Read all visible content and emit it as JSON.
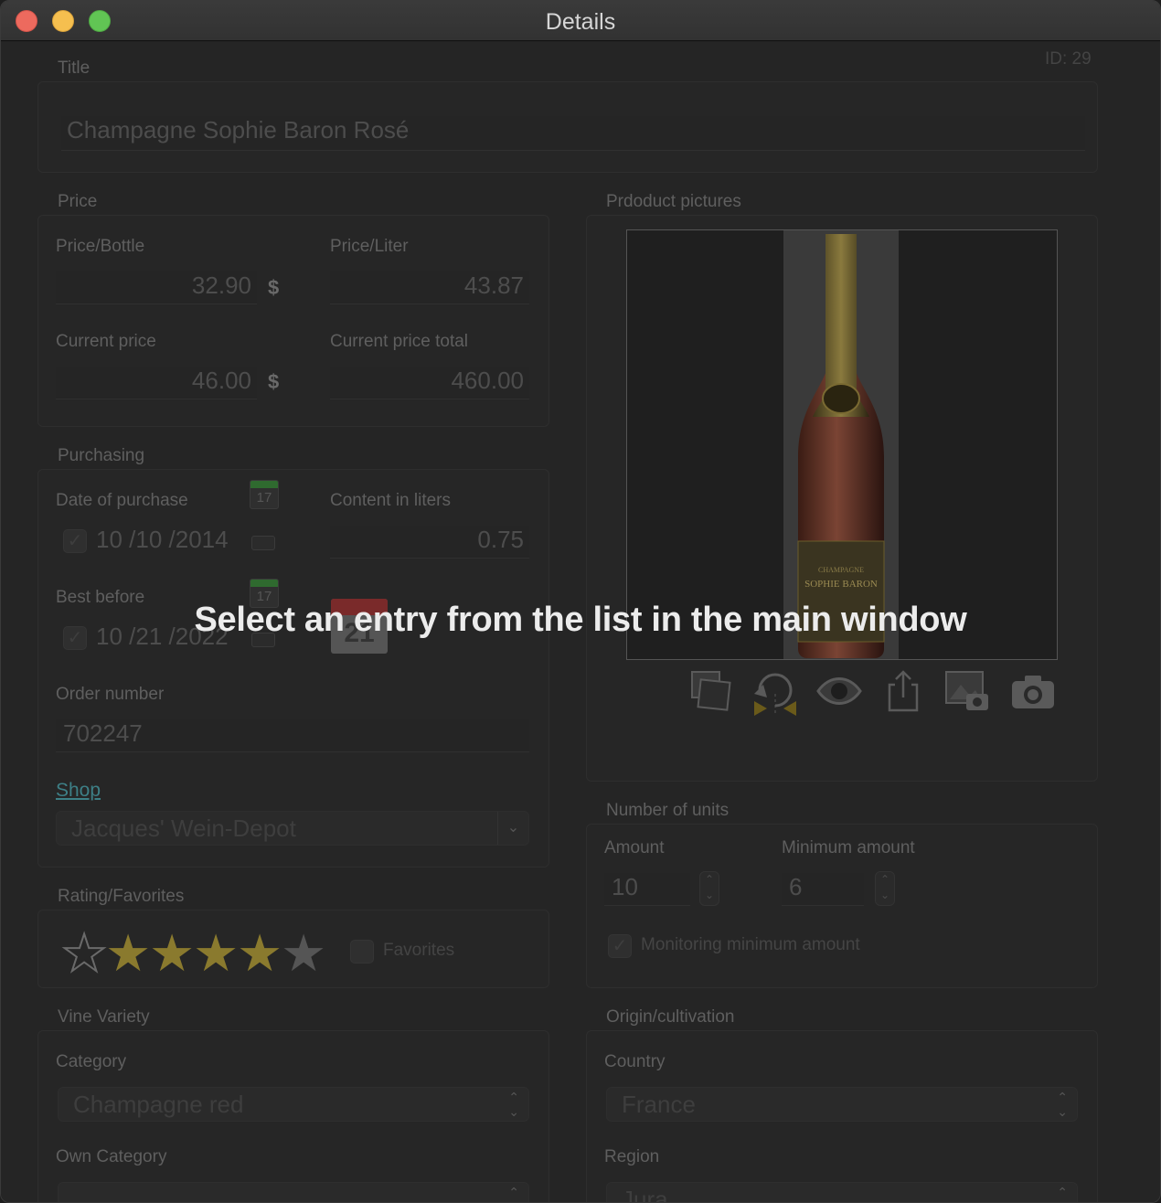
{
  "window": {
    "title": "Details"
  },
  "id_label": "ID: 29",
  "overlay_message": "Select an entry from the list in the main window",
  "title_section": {
    "label": "Title",
    "value": "Champagne Sophie Baron Rosé"
  },
  "price": {
    "label": "Price",
    "price_bottle_label": "Price/Bottle",
    "price_bottle_value": "32.90",
    "price_bottle_currency": "$",
    "price_liter_label": "Price/Liter",
    "price_liter_value": "43.87",
    "current_price_label": "Current price",
    "current_price_value": "46.00",
    "current_price_currency": "$",
    "current_total_label": "Current price total",
    "current_total_value": "460.00"
  },
  "purchasing": {
    "label": "Purchasing",
    "date_purchase_label": "Date of purchase",
    "date_purchase_value": "10 /10 /2014",
    "content_label": "Content in liters",
    "content_value": "0.75",
    "best_before_label": "Best before",
    "best_before_value": "10 /21 /2022",
    "calendar_day": "17",
    "calendar_big_day": "21",
    "order_label": "Order number",
    "order_value": "702247",
    "shop_label": "Shop",
    "shop_value": "Jacques' Wein-Depot"
  },
  "rating": {
    "label": "Rating/Favorites",
    "stars": 4,
    "max_stars": 5,
    "favorites_label": "Favorites",
    "star_filled_color": "#8a7a2e",
    "star_empty_color": "#555555"
  },
  "pictures": {
    "label": "Prdoduct pictures",
    "bottle_text_top": "CHAMPAGNE",
    "bottle_text_brand": "SOPHIE BARON",
    "tools": [
      "gallery-icon",
      "rotate-icon",
      "eye-icon",
      "share-icon",
      "photo-camera-import-icon",
      "camera-icon"
    ]
  },
  "units": {
    "label": "Number of units",
    "amount_label": "Amount",
    "amount_value": "10",
    "min_label": "Minimum amount",
    "min_value": "6",
    "monitoring_label": "Monitoring minimum amount"
  },
  "vine": {
    "label": "Vine Variety",
    "category_label": "Category",
    "category_value": "Champagne red",
    "own_category_label": "Own Category",
    "own_category_value": ""
  },
  "origin": {
    "label": "Origin/cultivation",
    "country_label": "Country",
    "country_value": "France",
    "region_label": "Region",
    "region_value": "Jura"
  }
}
